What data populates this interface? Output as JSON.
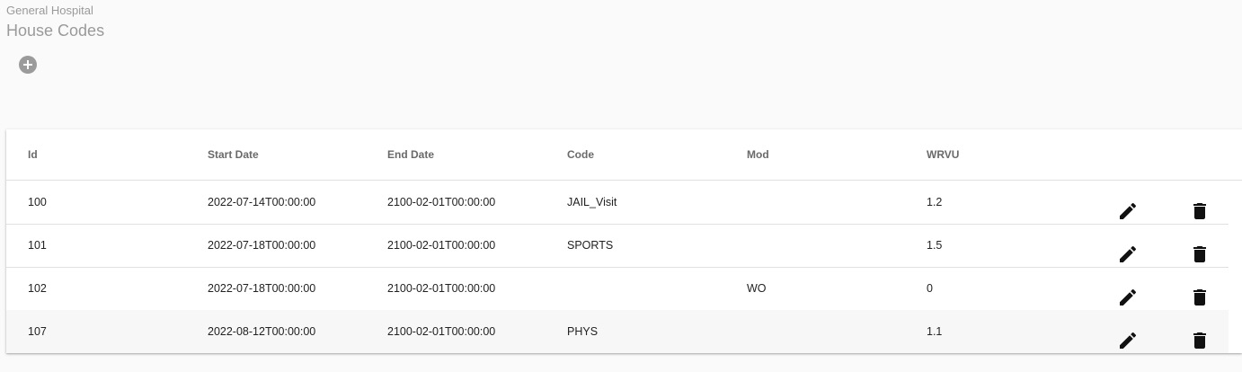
{
  "page": {
    "org_name": "General Hospital",
    "title": "House Codes"
  },
  "actions": {
    "add_icon": "add-circle-icon"
  },
  "table": {
    "headers": {
      "id": "Id",
      "start_date": "Start Date",
      "end_date": "End Date",
      "code": "Code",
      "mod": "Mod",
      "wrvu": "WRVU"
    },
    "rows": [
      {
        "id": "100",
        "start_date": "2022-07-14T00:00:00",
        "end_date": "2100-02-01T00:00:00",
        "code": "JAIL_Visit",
        "mod": "",
        "wrvu": "1.2"
      },
      {
        "id": "101",
        "start_date": "2022-07-18T00:00:00",
        "end_date": "2100-02-01T00:00:00",
        "code": "SPORTS",
        "mod": "",
        "wrvu": "1.5"
      },
      {
        "id": "102",
        "start_date": "2022-07-18T00:00:00",
        "end_date": "2100-02-01T00:00:00",
        "code": "",
        "mod": "WO",
        "wrvu": "0"
      },
      {
        "id": "107",
        "start_date": "2022-08-12T00:00:00",
        "end_date": "2100-02-01T00:00:00",
        "code": "PHYS",
        "mod": "",
        "wrvu": "1.1"
      }
    ],
    "row_actions": {
      "edit_icon": "pencil-icon",
      "delete_icon": "trash-icon"
    }
  }
}
